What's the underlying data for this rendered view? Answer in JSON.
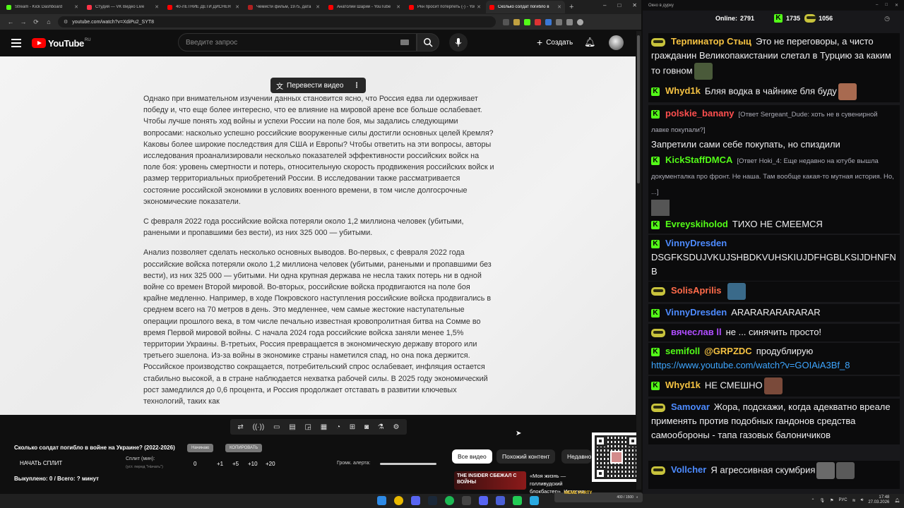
{
  "browser": {
    "tabs": [
      {
        "title": "Stream - Kick Dashboard",
        "color": "#53fc18"
      },
      {
        "title": "Студия — VK Видео Live",
        "color": "#ff3347"
      },
      {
        "title": "40-ЛЕТНИЕ ДЕТИ ДИСНЕЯ",
        "color": "#ff0000"
      },
      {
        "title": "Чемисти фильм, 1975, дата",
        "color": "#b02020"
      },
      {
        "title": "Анатолий Шарий - YouTube",
        "color": "#ff0000"
      },
      {
        "title": "Ркн просит потерпеть (-) - YouT",
        "color": "#ff0000"
      },
      {
        "title": "Сколько солдат погибло в",
        "color": "#ff0000"
      }
    ],
    "new_tab": "+",
    "url": "youtube.com/watch?v=XdiPu2_SYT8"
  },
  "youtube": {
    "logo_text": "YouTube",
    "country": "RU",
    "search_placeholder": "Введите запрос",
    "create_label": "Создать"
  },
  "video": {
    "translate_label": "Перевести видео",
    "paragraphs": [
      "Однако при внимательном изучении данных становится ясно, что Россия едва ли одерживает победу и, что еще более интересно, что ее влияние на мировой арене все больше ослабевает. Чтобы лучше понять ход войны и успехи России на поле боя, мы задались следующими вопросами: насколько успешно российские вооруженные силы достигли основных целей Кремля? Каковы более широкие последствия для США и Европы? Чтобы ответить на эти вопросы, авторы исследования проанализировали несколько показателей эффективности российских войск на поле боя: уровень смертности и потерь, относительную скорость продвижения российских войск и размер территориальных приобретений России. В исследовании также рассматривается состояние российской экономики в условиях военного времени, в том числе долгосрочные экономические показатели.",
      "С февраля 2022 года российские войска потеряли около 1,2 миллиона человек (убитыми, ранеными и пропавшими без вести), из них 325 000 — убитыми.",
      "Анализ позволяет сделать несколько основных выводов. Во-первых, с февраля 2022 года российские войска потеряли около 1,2 миллиона человек (убитыми, ранеными и пропавшими без вести), из них 325 000 — убитыми. Ни одна крупная держава не несла таких потерь ни в одной войне со времен Второй мировой. Во-вторых, российские войска продвигаются на поле боя крайне медленно. Например, в ходе Покровского наступления российские войска продвигались в среднем всего на 70 метров в день. Это медленнее, чем самые жестокие наступательные операции прошлого века, в том числе печально известная кровопролитная битва на Сомме во время Первой мировой войны. С начала 2024 года российские войска заняли менее 1,5% территории Украины. В-третьих, Россия превращается в экономическую державу второго или третьего эшелона. Из-за войны в экономике страны наметился спад, но она пока держится. Российское производство сокращается, потребительский спрос ослабевает, инфляция остается стабильно высокой, а в стране наблюдается нехватка рабочей силы. В 2025 году экономический рост замедлился до 0,6 процента, и Россия продолжает отставать в развитии ключевых технологий, таких как"
    ]
  },
  "panel": {
    "title": "Сколько солдат погибло в войне на Украине? (2022-2026)",
    "btn_start": "Начинаю",
    "btn_copy": "КОПИРОВАТЬ",
    "start_split": "НАЧАТЬ СПЛИТ",
    "split_label": "Сплит (мин):",
    "split_sub": "(уст. перед \"Начать\")",
    "split_value": "0",
    "steps": [
      "+1",
      "+5",
      "+10",
      "+20"
    ],
    "alert_label": "Громк. алерта:",
    "bought": "Выкуплено: 0 / Всего: ? минут"
  },
  "chips": [
    "Все видео",
    "Похожий контент",
    "Недавно"
  ],
  "suggested": {
    "thumb_text": "THE INSIDER СБЕЖАЛ С ВОЙНЫ",
    "title": "«Моя жизнь — голливудский блокбастер». История казак..."
  },
  "chat": {
    "header": "Окно в дурку",
    "online_label": "Online:",
    "online": "2791",
    "kick_count": "1735",
    "vk_count": "1056",
    "messages": [
      {
        "nick": "Терпинатор Стыц",
        "color": "#f5c242",
        "text": "Это не переговоры, а чисто гражданин Великопакистании слетал в Турцию за каким то говном"
      },
      {
        "nick": "Whyd1k",
        "color": "#f5c242",
        "text": "Бляя водка в чайнике бля буду"
      },
      {
        "nick": "polskie_banany",
        "color": "#ff4f4f",
        "reply": "[Ответ Sergeant_Dude: хоть не в сувенирной лавке покупали?]",
        "text": "Запретили сами себе покупать, но спиздили"
      },
      {
        "nick": "KickStaffDMCA",
        "color": "#53fc18",
        "reply": "[Ответ Hoki_4: Еще недавно на ютубе вышла документалка про фронт. Не наша. Там вообще какая-то мутная история. Но, ...]",
        "text": ""
      },
      {
        "nick": "Evreyskiholod",
        "color": "#53fc18",
        "text": "ТИХО НЕ СМЕЕМСЯ"
      },
      {
        "nick": "VinnyDresden",
        "color": "#4d8bff",
        "text": "DSGFKSDUJVKUJSHBDKVUHSKIUJDFHGBLKSIJDHNFNB"
      },
      {
        "nick": "SolisAprilis",
        "color": "#ff6b4a",
        "text": ""
      },
      {
        "nick": "VinnyDresden",
        "color": "#4d8bff",
        "text": "ARARARARARARAR"
      },
      {
        "nick": "вячеслав ll",
        "color": "#b04dff",
        "text": "не ... синячить просто!"
      },
      {
        "nick": "semifoll",
        "color": "#53fc18",
        "mention": "@GRPZDC",
        "text": "продублирую",
        "link": "https://www.youtube.com/watch?v=GOIAiA3Bf_8"
      },
      {
        "nick": "Whyd1k",
        "color": "#f5c242",
        "text": "НЕ СМЕШНО"
      },
      {
        "nick": "Samovar",
        "color": "#4d8bff",
        "text": "Жора, подскажи, когда адекватно вреале применять против подобных гандонов средства самообороны - тапа газовых балоничиков"
      },
      {
        "nick": "Vollcher",
        "color": "#4d8bff",
        "text": "Я агрессивная скумбрия"
      }
    ]
  },
  "taskbar": {
    "lang": "РУС",
    "time": "17:48",
    "date": "27.03.2026",
    "donate_label": "MEME PARTY",
    "donate_progress": "400 / 1500"
  }
}
